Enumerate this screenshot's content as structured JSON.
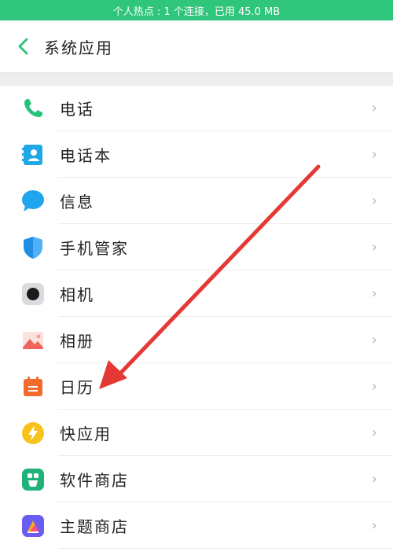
{
  "status_bar": {
    "text": "个人热点 : 1 个连接，已用 45.0 MB"
  },
  "header": {
    "title": "系统应用"
  },
  "list": [
    {
      "label": "电话",
      "icon": "phone-icon"
    },
    {
      "label": "电话本",
      "icon": "contacts-icon"
    },
    {
      "label": "信息",
      "icon": "message-icon"
    },
    {
      "label": "手机管家",
      "icon": "shield-icon"
    },
    {
      "label": "相机",
      "icon": "camera-icon"
    },
    {
      "label": "相册",
      "icon": "gallery-icon"
    },
    {
      "label": "日历",
      "icon": "calendar-icon"
    },
    {
      "label": "快应用",
      "icon": "quick-app-icon"
    },
    {
      "label": "软件商店",
      "icon": "app-store-icon"
    },
    {
      "label": "主题商店",
      "icon": "theme-store-icon"
    }
  ],
  "chevron": "›",
  "colors": {
    "status_bar": "#2fc57b",
    "accent": "#2fc57b",
    "annotation_arrow": "#e53935"
  }
}
